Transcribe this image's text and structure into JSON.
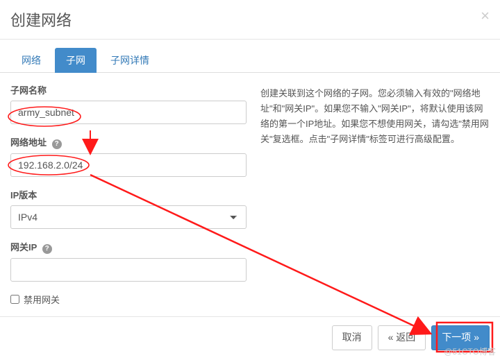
{
  "modal": {
    "title": "创建网络",
    "close": "×"
  },
  "tabs": {
    "network": "网络",
    "subnet": "子网",
    "subnet_detail": "子网详情"
  },
  "form": {
    "subnet_name": {
      "label": "子网名称",
      "value": "army_subnet"
    },
    "network_address": {
      "label": "网络地址",
      "value": "192.168.2.0/24"
    },
    "ip_version": {
      "label": "IP版本",
      "value": "IPv4"
    },
    "gateway_ip": {
      "label": "网关IP",
      "value": ""
    },
    "disable_gateway": {
      "label": "禁用网关"
    },
    "help_icon": "?"
  },
  "help": {
    "text": "创建关联到这个网络的子网。您必须输入有效的\"网络地址\"和\"网关IP\"。如果您不输入\"网关IP\"，将默认使用该网络的第一个IP地址。如果您不想使用网关，请勾选\"禁用网关\"复选框。点击\"子网详情\"标签可进行高级配置。"
  },
  "footer": {
    "cancel": "取消",
    "back": "« 返回",
    "next": "下一项 »"
  },
  "watermark": "@51CTO博客"
}
